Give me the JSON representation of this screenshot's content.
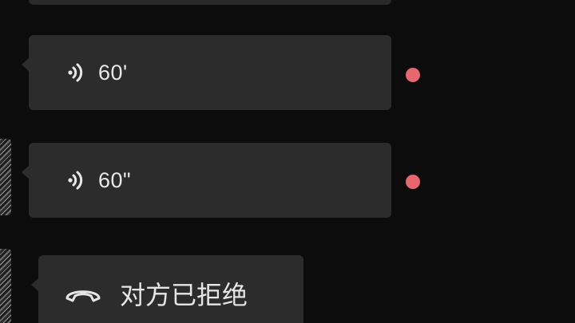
{
  "messages": [
    {
      "type": "voice",
      "duration": "60'"
    },
    {
      "type": "voice",
      "duration": "60\""
    },
    {
      "type": "call",
      "status_text": "对方已拒绝"
    }
  ],
  "icons": {
    "voice": "voice-message-icon",
    "call": "hang-up-phone-icon"
  },
  "colors": {
    "background": "#0c0c0c",
    "bubble": "#2c2c2c",
    "unread_dot": "#e8666d",
    "text": "#e8e8e8"
  }
}
